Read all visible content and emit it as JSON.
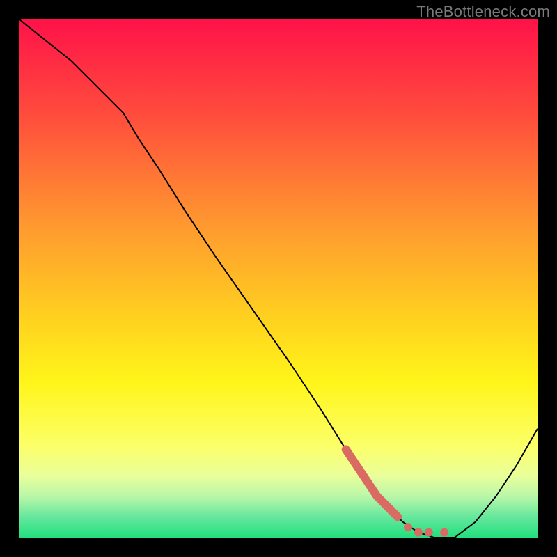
{
  "attribution": "TheBottleneck.com",
  "chart_data": {
    "type": "line",
    "title": "",
    "xlabel": "",
    "ylabel": "",
    "xlim": [
      0,
      100
    ],
    "ylim": [
      0,
      100
    ],
    "grid": false,
    "legend": false,
    "background": {
      "type": "vertical-gradient",
      "stops": [
        {
          "pos": 0.0,
          "color": "#ff1249"
        },
        {
          "pos": 0.18,
          "color": "#ff4b3d"
        },
        {
          "pos": 0.4,
          "color": "#ff9a2f"
        },
        {
          "pos": 0.58,
          "color": "#ffd21f"
        },
        {
          "pos": 0.7,
          "color": "#fff51a"
        },
        {
          "pos": 0.82,
          "color": "#fcff66"
        },
        {
          "pos": 0.88,
          "color": "#eaff9a"
        },
        {
          "pos": 0.92,
          "color": "#baf7a8"
        },
        {
          "pos": 0.96,
          "color": "#66e79d"
        },
        {
          "pos": 1.0,
          "color": "#23e07f"
        }
      ]
    },
    "series": [
      {
        "name": "curve",
        "color": "#000000",
        "stroke_width": 2,
        "x": [
          0,
          5,
          10,
          15,
          20,
          23,
          27,
          32,
          38,
          45,
          52,
          58,
          63,
          67,
          71,
          74,
          77,
          80,
          84,
          88,
          92,
          96,
          100
        ],
        "y": [
          100,
          96,
          92,
          87,
          82,
          77,
          71,
          63,
          54,
          44,
          34,
          25,
          17,
          11,
          6,
          3,
          1,
          0,
          0,
          3,
          8,
          14,
          21
        ]
      },
      {
        "name": "highlight-dots",
        "color": "#d96b63",
        "type": "scatter",
        "marker_size": 12,
        "x": [
          63,
          65,
          67,
          69,
          71,
          73,
          75,
          77,
          79,
          82
        ],
        "y": [
          17,
          14,
          11,
          8,
          6,
          4,
          2,
          1,
          1,
          1
        ]
      }
    ]
  }
}
